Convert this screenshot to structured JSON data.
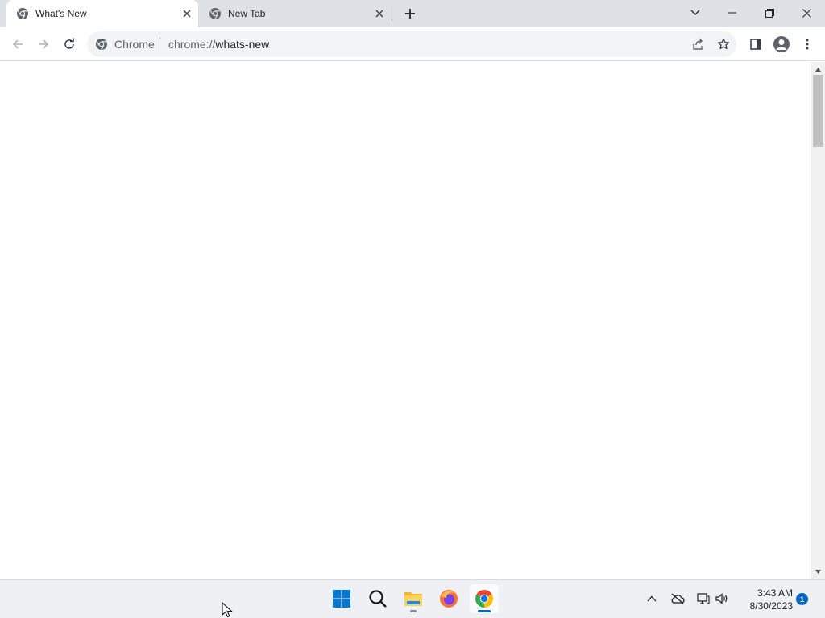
{
  "tabs": [
    {
      "title": "What's New",
      "active": true
    },
    {
      "title": "New Tab",
      "active": false
    }
  ],
  "omnibox": {
    "chip": "Chrome",
    "url_scheme": "chrome://",
    "url_host": "whats-new"
  },
  "taskbar": {
    "time": "3:43 AM",
    "date": "8/30/2023",
    "notification_count": "1",
    "apps": [
      "start-icon",
      "search-icon",
      "file-explorer-icon",
      "firefox-icon",
      "chrome-icon"
    ]
  },
  "colors": {
    "tabstrip_bg": "#dee1e6",
    "omnibox_bg": "#f1f3f4",
    "taskbar_bg": "#eef0f4",
    "accent": "#0067c0"
  }
}
